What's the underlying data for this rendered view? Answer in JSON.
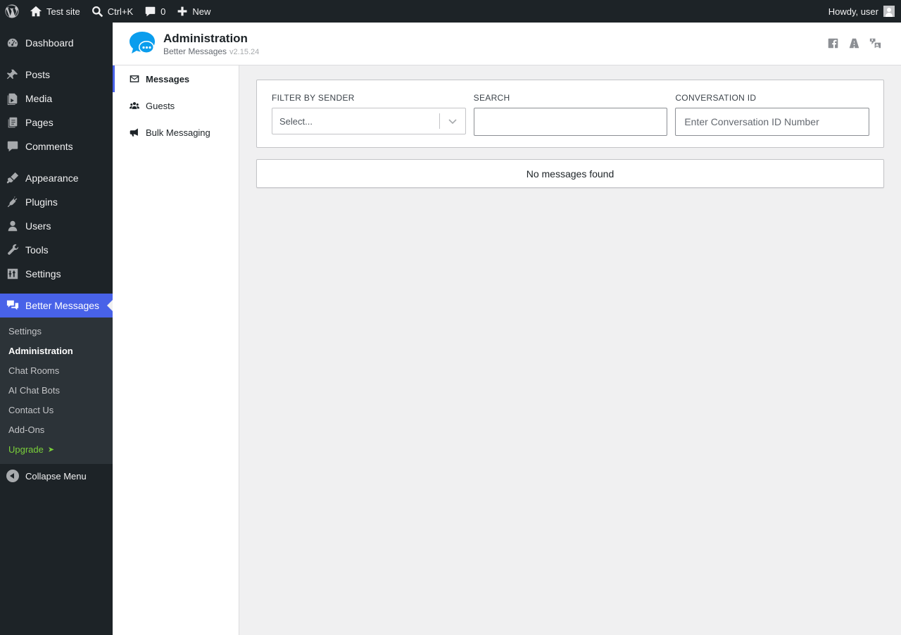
{
  "adminbar": {
    "site_name": "Test site",
    "search_shortcut": "Ctrl+K",
    "comments_count": "0",
    "new_label": "New",
    "greeting": "Howdy, user"
  },
  "sidebar": {
    "items": [
      {
        "label": "Dashboard",
        "icon": "dashboard-icon"
      },
      {
        "label": "Posts",
        "icon": "pin-icon"
      },
      {
        "label": "Media",
        "icon": "media-icon"
      },
      {
        "label": "Pages",
        "icon": "pages-icon"
      },
      {
        "label": "Comments",
        "icon": "comment-icon"
      },
      {
        "label": "Appearance",
        "icon": "brush-icon"
      },
      {
        "label": "Plugins",
        "icon": "plug-icon"
      },
      {
        "label": "Users",
        "icon": "user-icon"
      },
      {
        "label": "Tools",
        "icon": "wrench-icon"
      },
      {
        "label": "Settings",
        "icon": "sliders-icon"
      },
      {
        "label": "Better Messages",
        "icon": "messages-icon"
      }
    ],
    "submenu": [
      "Settings",
      "Administration",
      "Chat Rooms",
      "AI Chat Bots",
      "Contact Us",
      "Add-Ons",
      "Upgrade"
    ],
    "upgrade_arrow": "➤",
    "collapse_label": "Collapse Menu"
  },
  "header": {
    "title": "Administration",
    "plugin_name": "Better Messages",
    "version": "v2.15.24"
  },
  "nav": {
    "items": [
      "Messages",
      "Guests",
      "Bulk Messaging"
    ]
  },
  "filters": {
    "sender_label": "FILTER BY SENDER",
    "sender_placeholder": "Select...",
    "search_label": "SEARCH",
    "search_value": "",
    "conversation_label": "CONVERSATION ID",
    "conversation_placeholder": "Enter Conversation ID Number"
  },
  "results": {
    "empty_text": "No messages found"
  },
  "colors": {
    "admin_dark": "#1d2327",
    "accent": "#4862e8",
    "upgrade_green": "#7ad03a",
    "logo_blue": "#0a9ded"
  }
}
